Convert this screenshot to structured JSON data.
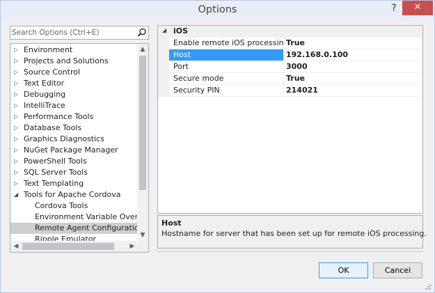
{
  "window": {
    "title": "Options",
    "help_glyph": "?",
    "close_glyph": "✕"
  },
  "search": {
    "placeholder": "Search Options (Ctrl+E)",
    "value": ""
  },
  "tree": {
    "items": [
      {
        "label": "Environment",
        "expander": "▷",
        "indent": 0
      },
      {
        "label": "Projects and Solutions",
        "expander": "▷",
        "indent": 0
      },
      {
        "label": "Source Control",
        "expander": "▷",
        "indent": 0
      },
      {
        "label": "Text Editor",
        "expander": "▷",
        "indent": 0
      },
      {
        "label": "Debugging",
        "expander": "▷",
        "indent": 0
      },
      {
        "label": "IntelliTrace",
        "expander": "▷",
        "indent": 0
      },
      {
        "label": "Performance Tools",
        "expander": "▷",
        "indent": 0
      },
      {
        "label": "Database Tools",
        "expander": "▷",
        "indent": 0
      },
      {
        "label": "Graphics Diagnostics",
        "expander": "▷",
        "indent": 0
      },
      {
        "label": "NuGet Package Manager",
        "expander": "▷",
        "indent": 0
      },
      {
        "label": "PowerShell Tools",
        "expander": "▷",
        "indent": 0
      },
      {
        "label": "SQL Server Tools",
        "expander": "▷",
        "indent": 0
      },
      {
        "label": "Text Templating",
        "expander": "▷",
        "indent": 0
      },
      {
        "label": "Tools for Apache Cordova",
        "expander": "◢",
        "indent": 0
      },
      {
        "label": "Cordova Tools",
        "expander": "",
        "indent": 1
      },
      {
        "label": "Environment Variable Overrides",
        "expander": "",
        "indent": 1
      },
      {
        "label": "Remote Agent Configuration",
        "expander": "",
        "indent": 1,
        "selected": true
      },
      {
        "label": "Ripple Emulator",
        "expander": "",
        "indent": 1
      }
    ]
  },
  "grid": {
    "category": "iOS",
    "category_expander": "◢",
    "properties": [
      {
        "name": "Enable remote iOS processing",
        "value": "True"
      },
      {
        "name": "Host",
        "value": "192.168.0.100",
        "selected": true
      },
      {
        "name": "Port",
        "value": "3000"
      },
      {
        "name": "Secure mode",
        "value": "True"
      },
      {
        "name": "Security PIN",
        "value": "214021"
      }
    ]
  },
  "description": {
    "title": "Host",
    "text": "Hostname for server that has been set up for remote iOS processing."
  },
  "buttons": {
    "ok": "OK",
    "cancel": "Cancel"
  },
  "scroll_glyphs": {
    "up": "▲",
    "down": "▼",
    "left": "◀",
    "right": "▶"
  },
  "colors": {
    "selection": "#3399ff",
    "close": "#c74f4f"
  }
}
